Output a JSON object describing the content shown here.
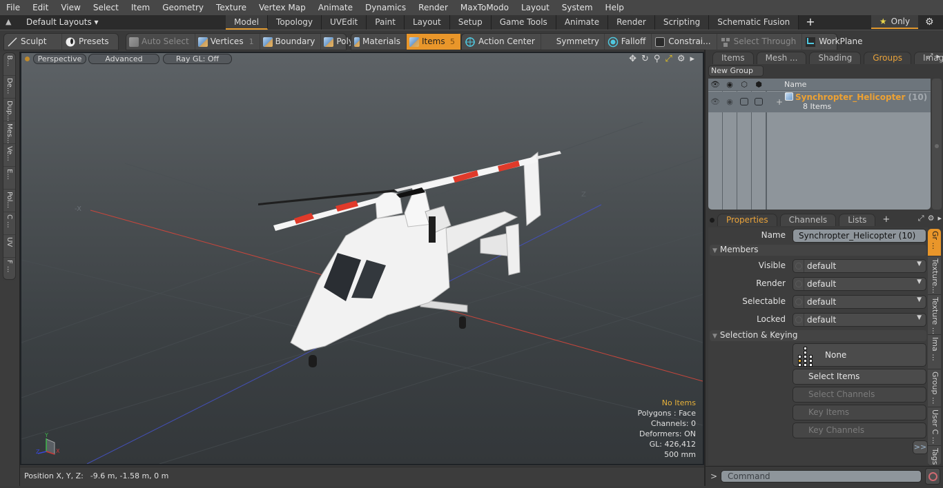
{
  "menu": [
    "File",
    "Edit",
    "View",
    "Select",
    "Item",
    "Geometry",
    "Texture",
    "Vertex Map",
    "Animate",
    "Dynamics",
    "Render",
    "MaxToModo",
    "Layout",
    "System",
    "Help"
  ],
  "layoutbar": {
    "layouts_label": "Default Layouts ▾",
    "tabs": [
      "Model",
      "Topology",
      "UVEdit",
      "Paint",
      "Layout",
      "Setup",
      "Game Tools",
      "Animate",
      "Render",
      "Scripting",
      "Schematic Fusion"
    ],
    "active_tab": "Model",
    "add_tab": "+",
    "only_label": "Only",
    "star": "★",
    "gear": "⚙"
  },
  "toolbar": {
    "sculpt": "Sculpt",
    "presets": "Presets",
    "auto_select": "Auto Select",
    "vertices": "Vertices",
    "vertices_count": "1",
    "boundary": "Boundary",
    "polygons": "Polygons",
    "materials": "Materials",
    "items": "Items",
    "items_count": "5",
    "action_center": "Action Center",
    "symmetry": "Symmetry",
    "falloff": "Falloff",
    "constraints": "Constrai...",
    "select_through": "Select Through",
    "workplane": "WorkPlane"
  },
  "left_tabs": [
    "B...",
    "De...",
    "Dup...",
    "Mes...",
    "Ve...",
    "E...",
    "Pol...",
    "C ...",
    "UV",
    "F ..."
  ],
  "viewport": {
    "view_mode": "Perspective",
    "shading": "Advanced",
    "raygl": "Ray GL: Off",
    "axis_neg_x": "-X",
    "axis_z": "Z",
    "info": {
      "selection": "No Items",
      "polygons": "Polygons : Face",
      "channels": "Channels: 0",
      "deformers": "Deformers: ON",
      "gl": "GL: 426,412",
      "scale": "500 mm"
    },
    "gizmo": {
      "x": "X",
      "y": "Y",
      "z": "Z"
    },
    "colors": {
      "x_axis": "#c8463c",
      "z_axis": "#4450b8",
      "info_highlight": "#e8b23a"
    }
  },
  "status": {
    "position_label": "Position X, Y, Z:",
    "position_value": "-9.6 m, -1.58 m, 0 m"
  },
  "right_panel": {
    "top_tabs": [
      "Items",
      "Mesh ...",
      "Shading",
      "Groups",
      "Images"
    ],
    "top_active": "Groups",
    "new_group": "New Group",
    "list_header_name": "Name",
    "group": {
      "name": "Synchropter_Helicopter",
      "count": "(10)",
      "type": ": Gr...",
      "sub": "8 Items"
    },
    "bottom_tabs": [
      "Properties",
      "Channels",
      "Lists"
    ],
    "bottom_active": "Properties",
    "properties": {
      "name_label": "Name",
      "name_value": "Synchropter_Helicopter (10)",
      "members_section": "Members",
      "fields": [
        {
          "label": "Visible",
          "value": "default"
        },
        {
          "label": "Render",
          "value": "default"
        },
        {
          "label": "Selectable",
          "value": "default"
        },
        {
          "label": "Locked",
          "value": "default"
        }
      ],
      "selection_section": "Selection & Keying",
      "none_button": "None",
      "select_items": "Select Items",
      "select_channels": "Select Channels",
      "key_items": "Key Items",
      "key_channels": "Key Channels",
      "expand": ">>"
    },
    "side_tabs": [
      "Gr ...",
      "Texture...",
      "Texture ...",
      "Ima ...",
      "Group ...",
      "User C ...",
      "Tags"
    ],
    "command_prompt": ">",
    "command_placeholder": "Command",
    "accent": "#e9962a"
  }
}
